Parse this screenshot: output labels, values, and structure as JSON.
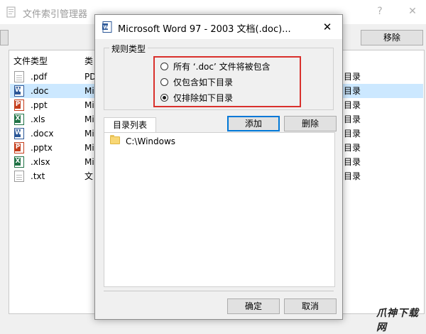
{
  "main_window": {
    "title": "文件索引管理器",
    "help_glyph": "?",
    "close_glyph": "✕",
    "remove_button": "移除",
    "columns": [
      "文件类型",
      "类"
    ],
    "rows": [
      {
        "ext": ".pdf",
        "type": "PD",
        "rule": "目录",
        "icon": "generic-file-icon",
        "selected": false
      },
      {
        "ext": ".doc",
        "type": "Mi",
        "rule": "目录",
        "icon": "word-file-icon",
        "selected": true
      },
      {
        "ext": ".ppt",
        "type": "Mi",
        "rule": "目录",
        "icon": "ppt-file-icon",
        "selected": false
      },
      {
        "ext": ".xls",
        "type": "Mi",
        "rule": "目录",
        "icon": "excel-file-icon",
        "selected": false
      },
      {
        "ext": ".docx",
        "type": "Mi",
        "rule": "目录",
        "icon": "word-file-icon",
        "selected": false
      },
      {
        "ext": ".pptx",
        "type": "Mi",
        "rule": "目录",
        "icon": "ppt-file-icon",
        "selected": false
      },
      {
        "ext": ".xlsx",
        "type": "Mi",
        "rule": "目录",
        "icon": "excel-file-icon",
        "selected": false
      },
      {
        "ext": ".txt",
        "type": "文",
        "rule": "目录",
        "icon": "generic-file-icon",
        "selected": false
      }
    ]
  },
  "dialog": {
    "title": "Microsoft Word 97 - 2003 文档(.doc)...",
    "close_glyph": "✕",
    "rule_group_label": "规则类型",
    "radio_options": [
      {
        "label": "所有 ‘.doc’ 文件将被包含",
        "checked": false
      },
      {
        "label": "仅包含如下目录",
        "checked": false
      },
      {
        "label": "仅排除如下目录",
        "checked": true
      }
    ],
    "dir_tab_label": "目录列表",
    "add_button": "添加",
    "delete_button": "删除",
    "directories": [
      "C:\\Windows"
    ],
    "ok_button": "确定",
    "cancel_button": "取消"
  },
  "watermark": "爪神下载网",
  "colors": {
    "highlight_border": "#d9302c",
    "selection": "#cce8ff",
    "default_button_border": "#0078d7"
  }
}
